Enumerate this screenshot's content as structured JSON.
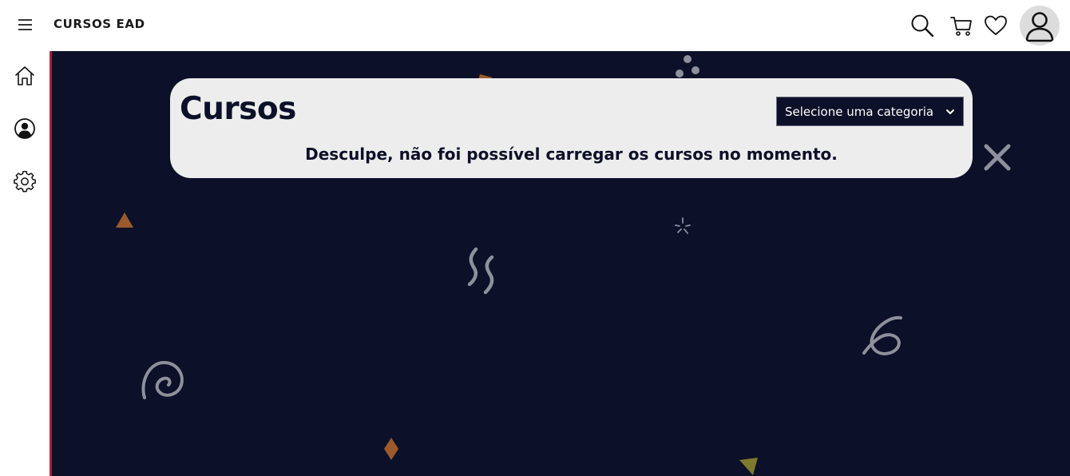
{
  "header": {
    "brand": "CURSOS EAD",
    "icons": {
      "menu": "hamburger-menu-icon",
      "search": "search-icon",
      "cart": "cart-icon",
      "favorites": "heart-icon",
      "profile": "user-avatar-icon"
    }
  },
  "sidebar": {
    "items": [
      {
        "icon": "home-icon"
      },
      {
        "icon": "user-circle-icon"
      },
      {
        "icon": "gear-icon"
      }
    ]
  },
  "card": {
    "title": "Cursos",
    "category_select": {
      "selected": "Selecione uma categoria"
    },
    "message": "Desculpe, não foi possível carregar os cursos no momento."
  },
  "colors": {
    "background": "#0c1028",
    "accent_border": "#a4243e",
    "card": "#ededed",
    "decor_orange": "#9a5a2a",
    "decor_olive": "#7d7a2e",
    "decor_gray": "#8e909b"
  }
}
